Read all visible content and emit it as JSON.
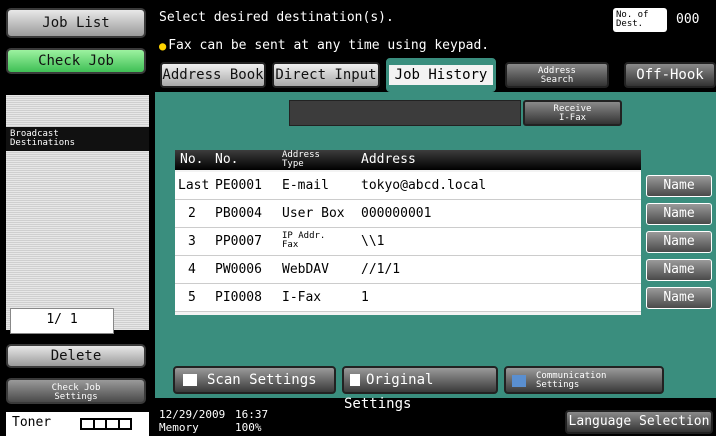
{
  "left_panel": {
    "job_list": "Job List",
    "check_job": "Check Job",
    "broadcast_destinations": "Broadcast\nDestinations",
    "page_counter": "1/ 1",
    "delete": "Delete",
    "check_job_settings": "Check Job\nSettings",
    "toner_label": "Toner",
    "toner_level": 1
  },
  "header": {
    "instruction": "Select desired destination(s).",
    "note": "Fax can be sent at any time using keypad.",
    "dest_label": "No. of\nDest.",
    "dest_count": "000"
  },
  "tabs": [
    {
      "label": "Address Book"
    },
    {
      "label": "Direct Input"
    },
    {
      "label": "Job History"
    },
    {
      "label": "Address\nSearch"
    },
    {
      "label": "Off-Hook"
    }
  ],
  "search_bar": {
    "value": "",
    "receive_button": "Receive\nI-Fax"
  },
  "table": {
    "headers": [
      "No.",
      "No.",
      "Address\nType",
      "Address"
    ],
    "rows": [
      {
        "no": "Last",
        "id": "PE0001",
        "type": "E-mail",
        "address": "tokyo@abcd.local",
        "name_button": "Name"
      },
      {
        "no": "2",
        "id": "PB0004",
        "type": "User Box",
        "address": "000000001",
        "name_button": "Name"
      },
      {
        "no": "3",
        "id": "PP0007",
        "type": "IP Addr.\nFax",
        "address": "\\\\1",
        "name_button": "Name"
      },
      {
        "no": "4",
        "id": "PW0006",
        "type": "WebDAV",
        "address": "//1/1",
        "name_button": "Name"
      },
      {
        "no": "5",
        "id": "PI0008",
        "type": "I-Fax",
        "address": "1",
        "name_button": "Name"
      }
    ]
  },
  "bottom_buttons": {
    "scan_settings": "Scan Settings",
    "original_settings": "Original Settings",
    "communication_settings": "Communication\nSettings"
  },
  "status_bar": {
    "date": "12/29/2009",
    "time": "16:37",
    "memory_label": "Memory",
    "memory_value": "100%",
    "language_selection": "Language Selection"
  }
}
